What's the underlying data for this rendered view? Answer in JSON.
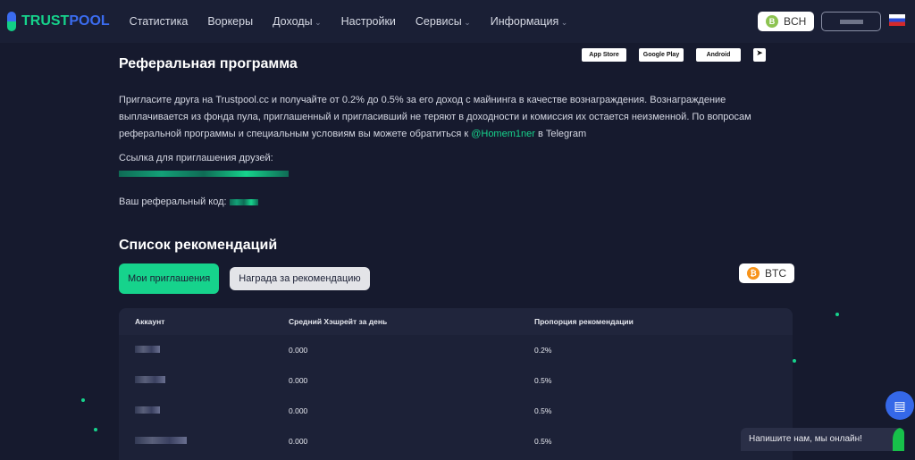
{
  "header": {
    "logo_a": "TRUST",
    "logo_b": "POOL",
    "nav": [
      "Статистика",
      "Воркеры",
      "Доходы",
      "Настройки",
      "Сервисы",
      "Информация"
    ],
    "coin": "BCH",
    "coin_color": "#8dc351"
  },
  "stores": [
    "App Store",
    "Google Play",
    "Android"
  ],
  "referral": {
    "title": "Реферальная программа",
    "text_before": "Пригласите друга на Trustpool.cc и получайте от 0.2% до 0.5% за его доход с майнинга в качестве вознаграждения. Вознаграждение выплачивается из фонда пула, приглашенный и пригласивший не теряют в доходности и комиссия их остается неизменной. По вопросам реферальной программы и специальным условиям вы можете обратиться к ",
    "contact": "@Homem1ner",
    "text_after": " в Telegram",
    "link_label": "Ссылка для приглашения друзей:",
    "code_label": "Ваш реферальный код:"
  },
  "list": {
    "title": "Список рекомендаций",
    "tabs": [
      "Мои приглашения",
      "Награда за рекомендацию"
    ],
    "coin": "BTC",
    "coin_color": "#f7931a",
    "columns": [
      "Аккаунт",
      "Средний Хэшрейт за день",
      "Пропорция рекомендации"
    ],
    "rows": [
      {
        "hash": "0.000",
        "ratio": "0.2%"
      },
      {
        "hash": "0.000",
        "ratio": "0.5%"
      },
      {
        "hash": "0.000",
        "ratio": "0.5%"
      },
      {
        "hash": "0.000",
        "ratio": "0.5%"
      }
    ]
  },
  "chat": {
    "text": "Напишите нам, мы онлайн!"
  },
  "colors": {
    "accent": "#16d38c",
    "brand_blue": "#3b6cf0"
  }
}
